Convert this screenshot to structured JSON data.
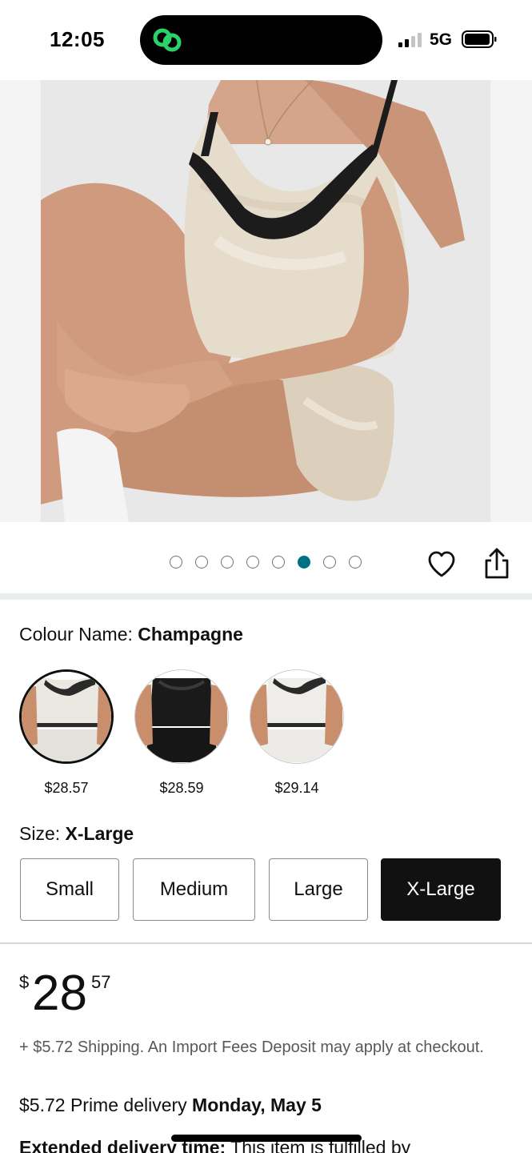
{
  "status_bar": {
    "time": "12:05",
    "network": "5G",
    "signal_bars_active": 2,
    "battery_level": 0.9,
    "island_icon": "linked-circles-icon",
    "island_icon_color": "#2bd16a"
  },
  "carousel": {
    "image_count": 8,
    "active_index": 5,
    "active_color": "#007185",
    "favorite_icon": "heart-outline-icon",
    "share_icon": "share-icon"
  },
  "colour": {
    "label": "Colour Name: ",
    "value": "Champagne",
    "options": [
      {
        "name": "Champagne",
        "price": "$28.57",
        "selected": true
      },
      {
        "name": "Black",
        "price": "$28.59",
        "selected": false
      },
      {
        "name": "White",
        "price": "$29.14",
        "selected": false
      }
    ]
  },
  "size": {
    "label": "Size: ",
    "value": "X-Large",
    "options": [
      {
        "label": "Small",
        "selected": false
      },
      {
        "label": "Medium",
        "selected": false
      },
      {
        "label": "Large",
        "selected": false
      },
      {
        "label": "X-Large",
        "selected": true
      }
    ]
  },
  "price": {
    "symbol": "$",
    "whole": "28",
    "fraction": "57"
  },
  "shipping_note": "+ $5.72 Shipping. An Import Fees Deposit may apply at checkout.",
  "delivery": {
    "prefix": "$5.72 Prime delivery ",
    "date": "Monday, May 5"
  },
  "extended": {
    "label": "Extended delivery time:",
    "text": " This item is fulfilled by"
  }
}
